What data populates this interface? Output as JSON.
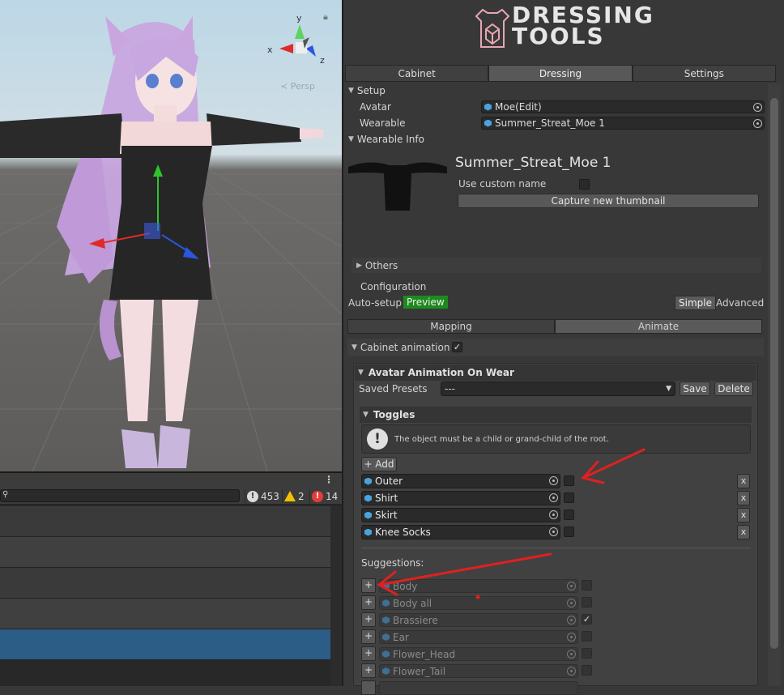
{
  "scene": {
    "gizmo": {
      "x": "x",
      "y": "y",
      "z": "z"
    },
    "persp_label": "≺ Persp"
  },
  "console": {
    "info_count": "453",
    "warn_count": "2",
    "error_count": "14"
  },
  "inspector": {
    "logo": {
      "line1": "DRESSING",
      "line2": "TOOLS"
    },
    "tabs": [
      "Cabinet",
      "Dressing",
      "Settings"
    ],
    "active_tab": "Dressing",
    "setup": {
      "header": "Setup",
      "avatar_label": "Avatar",
      "avatar_value": "Moe(Edit)",
      "wearable_label": "Wearable",
      "wearable_value": "Summer_Streat_Moe 1"
    },
    "wearable_info": {
      "header": "Wearable Info",
      "name": "Summer_Streat_Moe 1",
      "custom_name_label": "Use custom name",
      "capture_button": "Capture new thumbnail",
      "others_label": "Others"
    },
    "configuration": {
      "header": "Configuration",
      "auto_setup": "Auto-setup",
      "preview": "Preview",
      "simple": "Simple",
      "advanced": "Advanced",
      "mapping_tab": "Mapping",
      "animate_tab": "Animate",
      "cabinet_animation_label": "Cabinet animation"
    },
    "avatar_animation": {
      "header": "Avatar Animation On Wear",
      "saved_presets_label": "Saved Presets",
      "preset_value": "---",
      "save_button": "Save",
      "delete_button": "Delete"
    },
    "toggles": {
      "header": "Toggles",
      "info_message": "The object must be a child or grand-child of the root.",
      "add_button": "+ Add",
      "items": [
        {
          "name": "Outer",
          "checked": false
        },
        {
          "name": "Shirt",
          "checked": false
        },
        {
          "name": "Skirt",
          "checked": false
        },
        {
          "name": "Knee Socks",
          "checked": false
        }
      ],
      "remove_label": "x"
    },
    "suggestions": {
      "header": "Suggestions:",
      "add_label": "+",
      "items": [
        {
          "name": "Body",
          "checked": false
        },
        {
          "name": "Body all",
          "checked": false
        },
        {
          "name": "Brassiere",
          "checked": true
        },
        {
          "name": "Ear",
          "checked": false
        },
        {
          "name": "Flower_Head",
          "checked": false
        },
        {
          "name": "Flower_Tail",
          "checked": false
        }
      ]
    }
  },
  "colors": {
    "accent_selection": "#2c5d87",
    "preview_green": "#1e8a1e",
    "annotation_red": "#e02020"
  }
}
